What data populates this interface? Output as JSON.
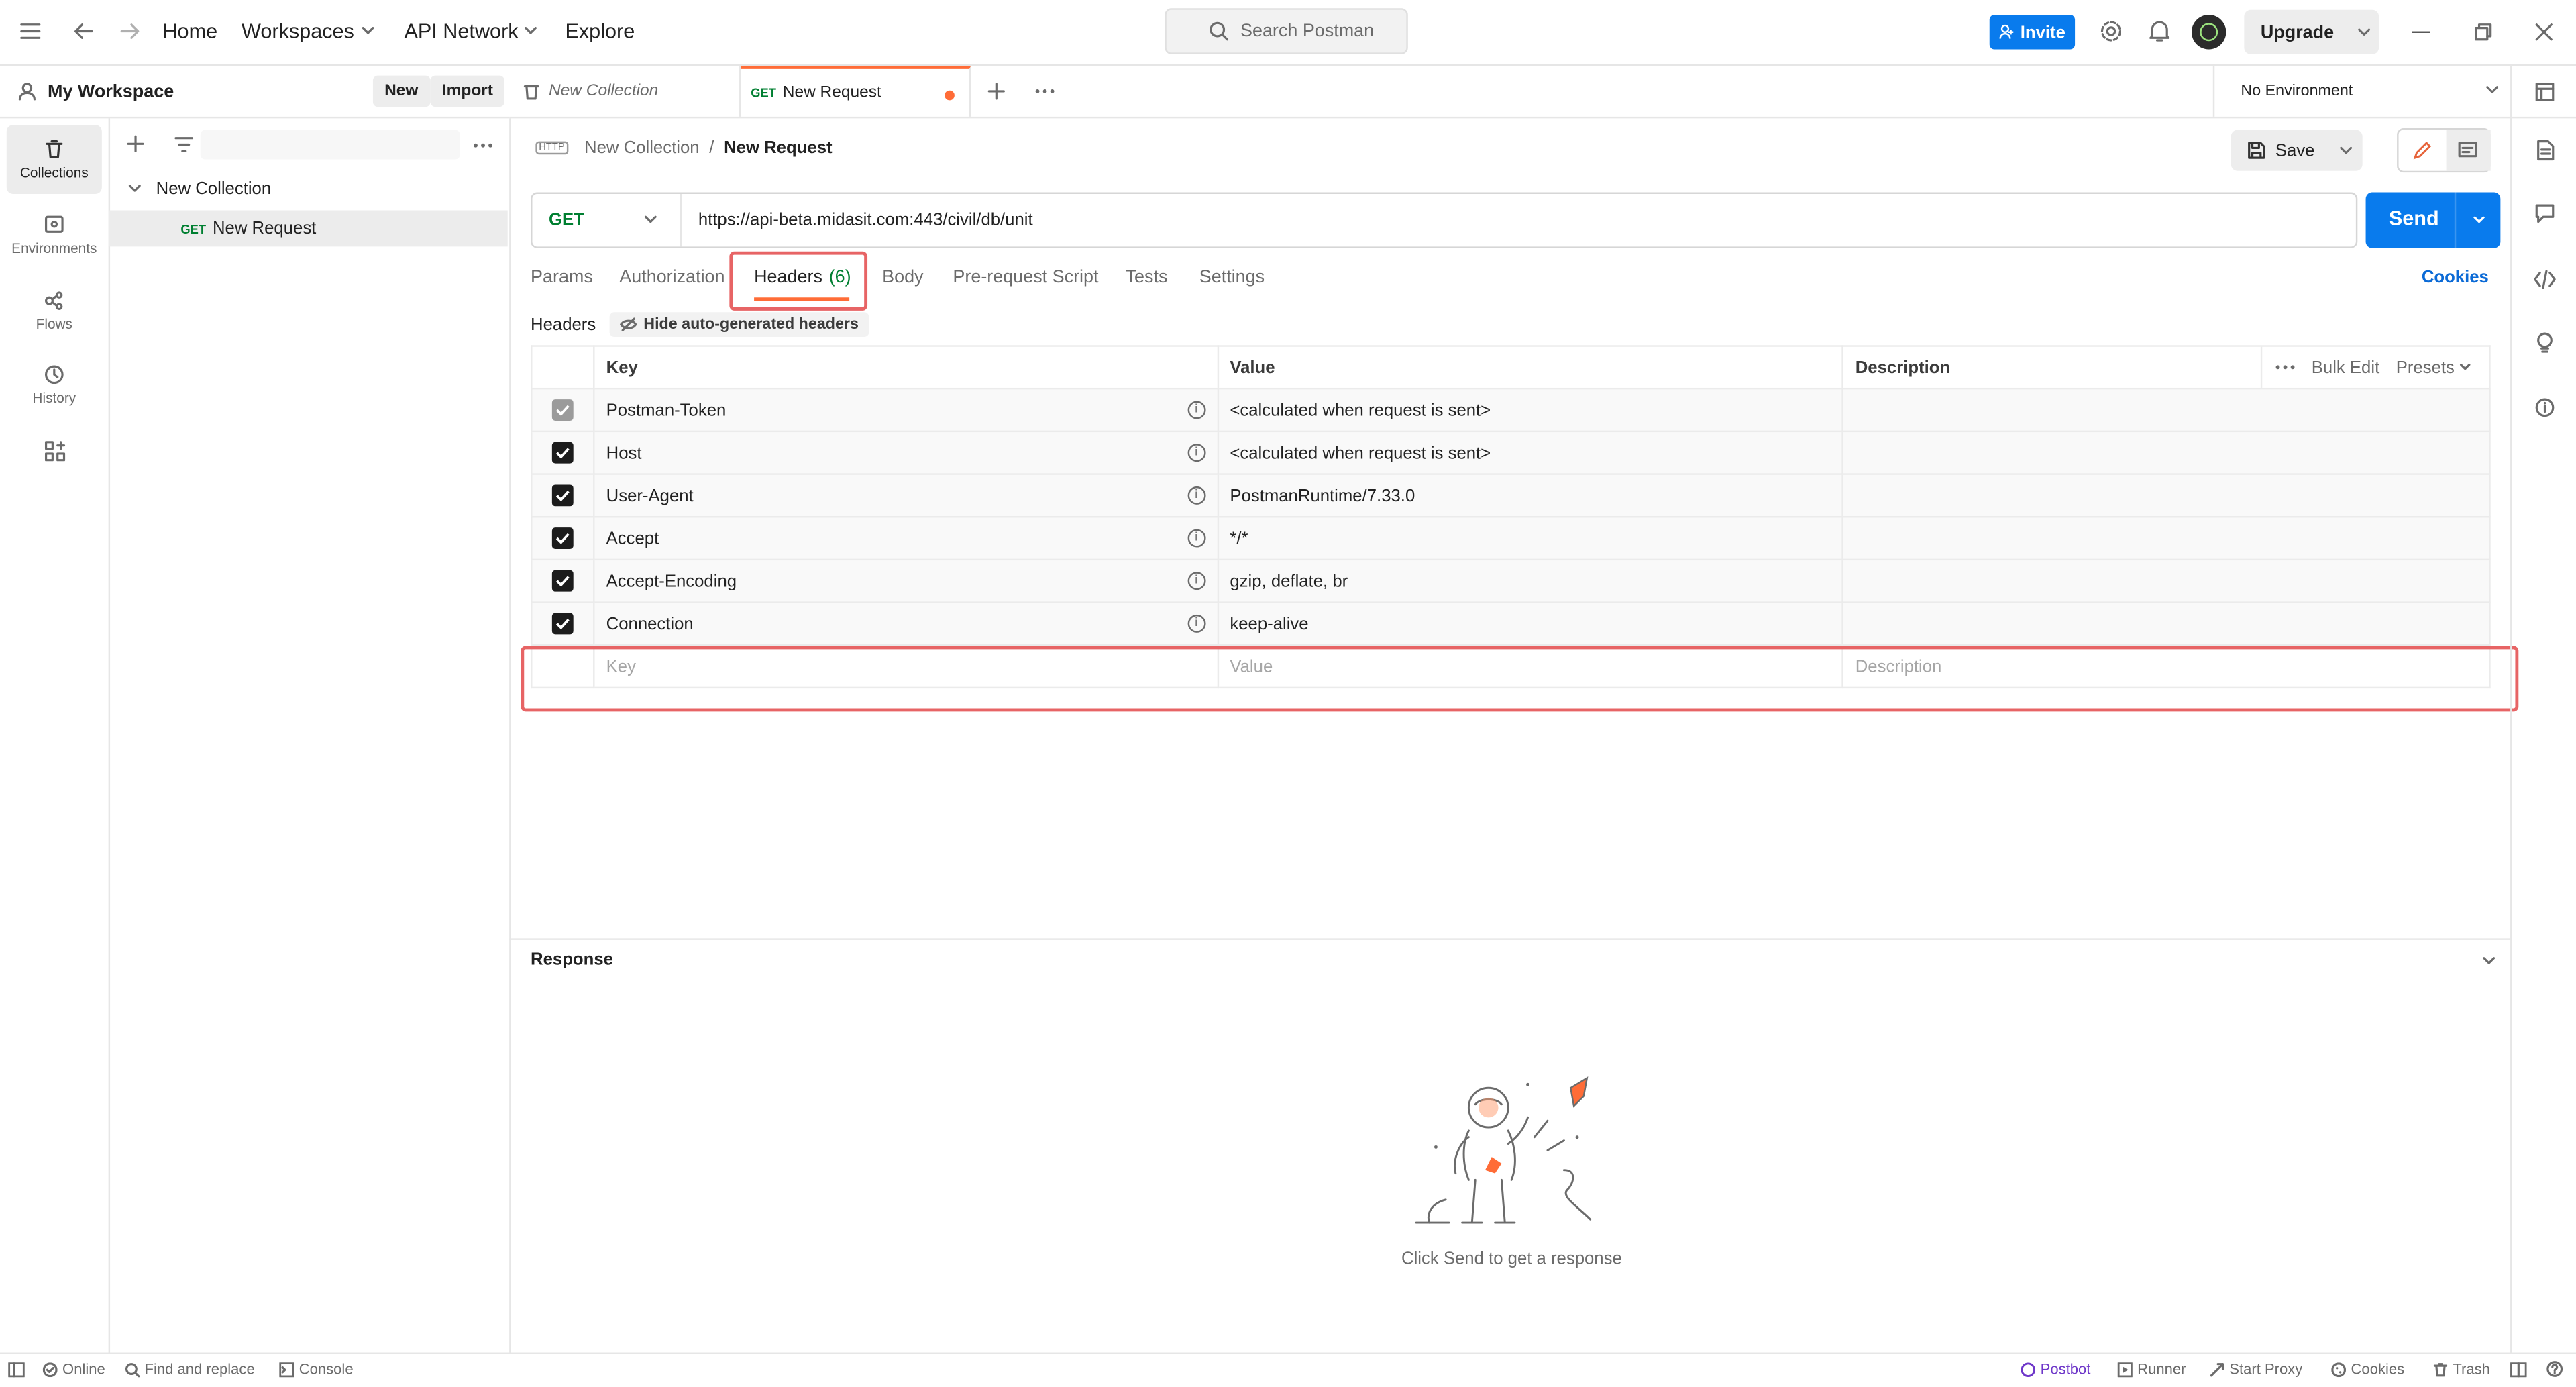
{
  "topbar": {
    "nav": [
      "Home",
      "Workspaces",
      "API Network",
      "Explore"
    ],
    "search_placeholder": "Search Postman",
    "invite": "Invite",
    "upgrade": "Upgrade"
  },
  "workspace": {
    "name": "My Workspace",
    "new": "New",
    "import": "Import"
  },
  "rail": [
    "Collections",
    "Environments",
    "Flows",
    "History"
  ],
  "tree": {
    "collection": "New Collection",
    "method": "GET",
    "request": "New Request"
  },
  "tabs": {
    "collection_tab": "New Collection",
    "request_method": "GET",
    "request_tab": "New Request",
    "environment": "No Environment"
  },
  "breadcrumb": {
    "collection": "New Collection",
    "separator": "/",
    "request": "New Request",
    "save": "Save"
  },
  "request": {
    "method": "GET",
    "url": "https://api-beta.midasit.com:443/civil/db/unit",
    "send": "Send"
  },
  "subtabs": {
    "params": "Params",
    "authorization": "Authorization",
    "headers": "Headers",
    "headers_count": "(6)",
    "body": "Body",
    "prerequest": "Pre-request Script",
    "tests": "Tests",
    "settings": "Settings",
    "cookies": "Cookies"
  },
  "headers_section": {
    "label": "Headers",
    "toggle": "Hide auto-generated headers"
  },
  "table": {
    "col_key": "Key",
    "col_value": "Value",
    "col_description": "Description",
    "bulk_edit": "Bulk Edit",
    "presets": "Presets",
    "rows": [
      {
        "key": "Postman-Token",
        "value": "<calculated when request is sent>"
      },
      {
        "key": "Host",
        "value": "<calculated when request is sent>"
      },
      {
        "key": "User-Agent",
        "value": "PostmanRuntime/7.33.0"
      },
      {
        "key": "Accept",
        "value": "*/*"
      },
      {
        "key": "Accept-Encoding",
        "value": "gzip, deflate, br"
      },
      {
        "key": "Connection",
        "value": "keep-alive"
      }
    ],
    "new_row": {
      "key_placeholder": "Key",
      "value_placeholder": "Value",
      "description_placeholder": "Description"
    }
  },
  "response": {
    "title": "Response",
    "empty_text": "Click Send to get a response"
  },
  "statusbar": {
    "online": "Online",
    "find_replace": "Find and replace",
    "console": "Console",
    "postbot": "Postbot",
    "runner": "Runner",
    "start_proxy": "Start Proxy",
    "cookies": "Cookies",
    "trash": "Trash"
  },
  "colors": {
    "accent_blue": "#097bed",
    "highlight_red": "#e76465",
    "tab_orange": "#ff6c37"
  }
}
